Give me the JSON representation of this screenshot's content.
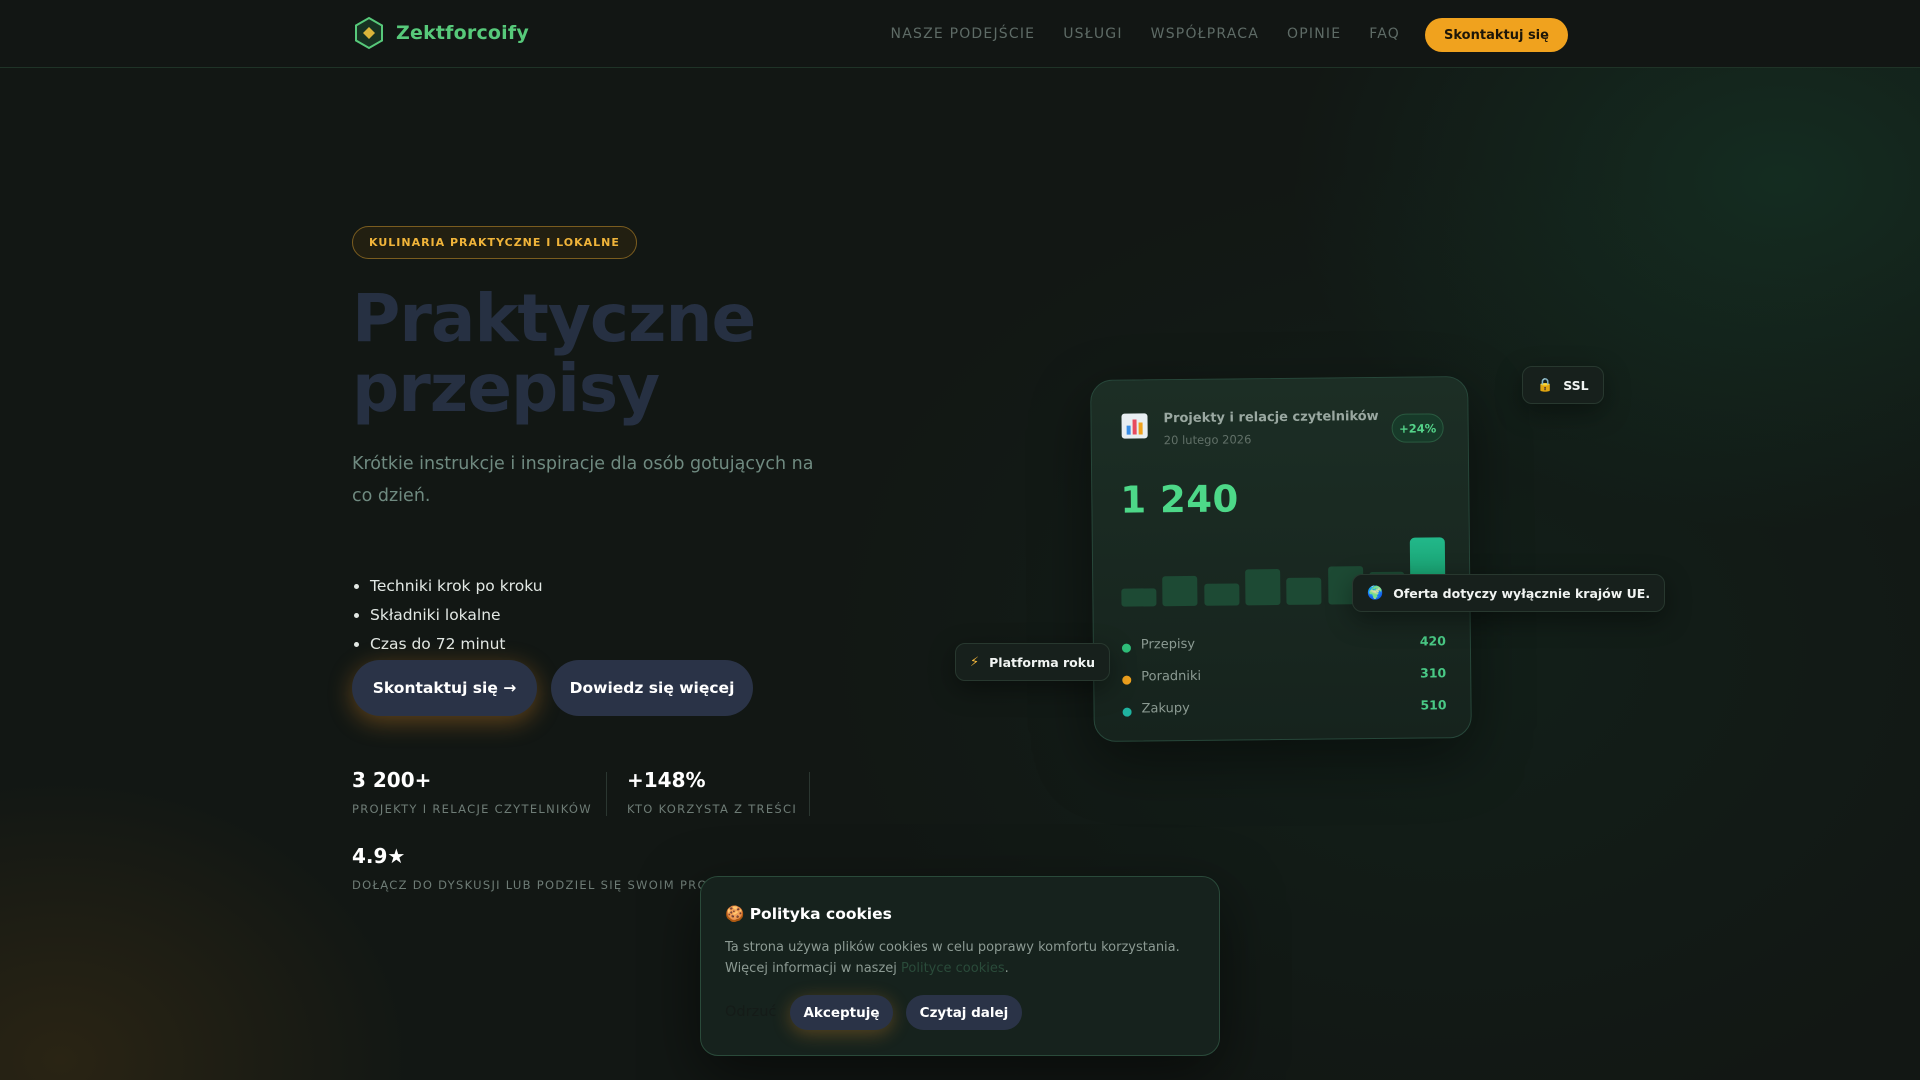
{
  "brand": {
    "name": "Zektforcoify",
    "accent": "#57c97a",
    "cta_color": "#f0a21e"
  },
  "nav": {
    "items": [
      "NASZE PODEJŚCIE",
      "USŁUGI",
      "WSPÓŁPRACA",
      "OPINIE",
      "FAQ"
    ],
    "cta": "Skontaktuj się"
  },
  "hero": {
    "badge": "KULINARIA PRAKTYCZNE I LOKALNE",
    "title_line1": "Praktyczne",
    "title_line2": "przepisy",
    "subtitle": "Krótkie instrukcje i inspiracje dla osób gotujących na co dzień.",
    "bullets": [
      "Techniki krok po kroku",
      "Składniki lokalne",
      "Czas do 72 minut"
    ],
    "primary_button": "Skontaktuj się →",
    "secondary_button": "Dowiedz się więcej"
  },
  "stats": [
    {
      "value": "3 200+",
      "label": "PROJEKTY I RELACJE CZYTELNIKÓW"
    },
    {
      "value": "+148%",
      "label": "KTO KORZYSTA Z TREŚCI"
    },
    {
      "value": "4.9★",
      "label": "DOŁĄCZ DO DYSKUSJI LUB PODZIEL SIĘ SWOIM PROJEKTEM"
    }
  ],
  "dashboard": {
    "icon": "bar-chart-icon",
    "title": "Projekty i relacje czytelników",
    "date": "20 lutego 2026",
    "change": "+24%",
    "big_number": "1 240",
    "bars": [
      0.28,
      0.45,
      0.33,
      0.55,
      0.41,
      0.58,
      0.49,
      1.0
    ],
    "legend": [
      {
        "label": "Przepisy",
        "value": "420",
        "color": "#2fbf7a"
      },
      {
        "label": "Poradniki",
        "value": "310",
        "color": "#f0a21e"
      },
      {
        "label": "Zakupy",
        "value": "510",
        "color": "#1fb3a0"
      }
    ]
  },
  "chips": {
    "ssl": "SSL",
    "eu": "Oferta dotyczy wyłącznie krajów UE.",
    "platform": "Platforma roku"
  },
  "cookie": {
    "title": "🍪 Polityka cookies",
    "text_before": "Ta strona używa plików cookies w celu poprawy komfortu korzystania. Więcej informacji w naszej ",
    "link": "Polityce cookies",
    "text_after": ".",
    "reject": "Odrzuć",
    "accept": "Akceptuję",
    "more": "Czytaj dalej"
  }
}
